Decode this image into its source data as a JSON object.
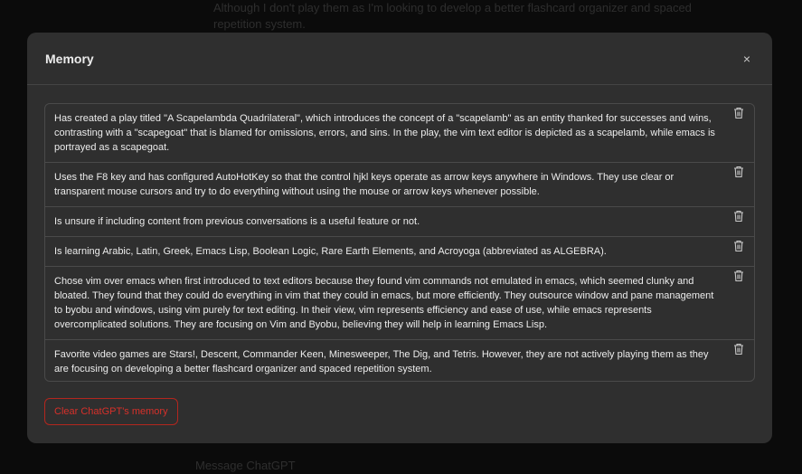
{
  "background": {
    "top_text": "Although I don't play them as I'm looking to develop a better flashcard organizer and spaced repetition system.",
    "bottom_text": "Message ChatGPT"
  },
  "modal": {
    "title": "Memory",
    "close_label": "×",
    "clear_button_label": "Clear ChatGPT's memory",
    "items": [
      {
        "text": "Has created a play titled \"A Scapelambda Quadrilateral\", which introduces the concept of a \"scapelamb\" as an entity thanked for successes and wins, contrasting with a \"scapegoat\" that is blamed for omissions, errors, and sins. In the play, the vim text editor is depicted as a scapelamb, while emacs is portrayed as a scapegoat."
      },
      {
        "text": "Uses the F8 key and has configured AutoHotKey so that the control hjkl keys operate as arrow keys anywhere in Windows. They use clear or transparent mouse cursors and try to do everything without using the mouse or arrow keys whenever possible."
      },
      {
        "text": "Is unsure if including content from previous conversations is a useful feature or not."
      },
      {
        "text": "Is learning Arabic, Latin, Greek, Emacs Lisp, Boolean Logic, Rare Earth Elements, and Acroyoga (abbreviated as ALGEBRA)."
      },
      {
        "text": "Chose vim over emacs when first introduced to text editors because they found vim commands not emulated in emacs, which seemed clunky and bloated. They found that they could do everything in vim that they could in emacs, but more efficiently. They outsource window and pane management to byobu and windows, using vim purely for text editing. In their view, vim represents efficiency and ease of use, while emacs represents overcomplicated solutions. They are focusing on Vim and Byobu, believing they will help in learning Emacs Lisp."
      },
      {
        "text": "Favorite video games are Stars!, Descent, Commander Keen, Minesweeper, The Dig, and Tetris. However, they are not actively playing them as they are focusing on developing a better flashcard organizer and spaced repetition system."
      }
    ]
  },
  "colors": {
    "modal_bg": "#2f2f2f",
    "danger": "#d6302a",
    "text": "#ececec"
  },
  "icons": {
    "close": "close-icon",
    "delete": "trash-icon"
  }
}
